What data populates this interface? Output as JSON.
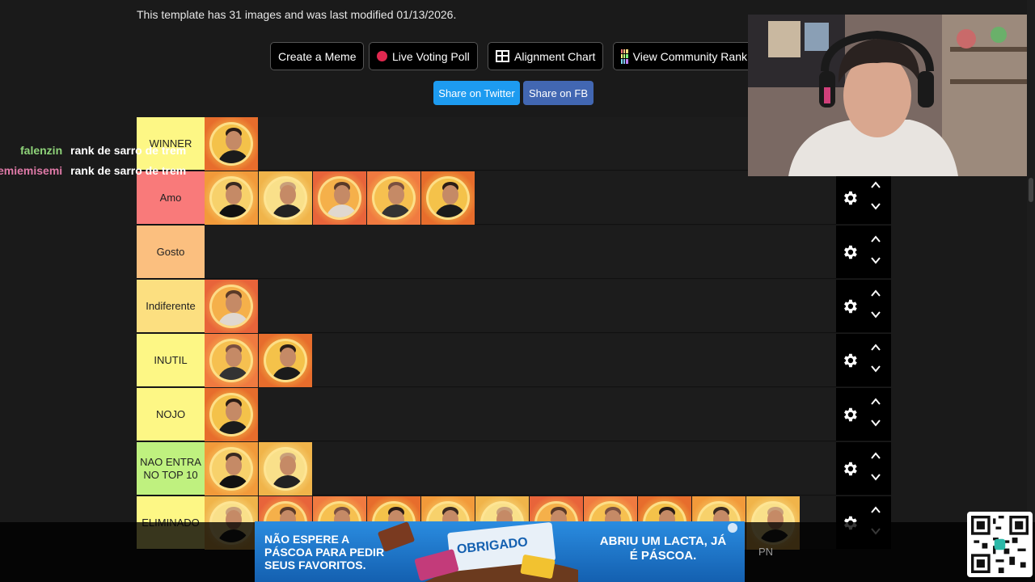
{
  "info_text": "This template has 31 images and was last modified 01/13/2026.",
  "buttons": {
    "create_meme": "Create a Meme",
    "live_poll": "Live Voting Poll",
    "alignment": "Alignment Chart",
    "community": "View Community Rank"
  },
  "share": {
    "twitter": "Share on Twitter",
    "fb": "Share on FB"
  },
  "chat": [
    {
      "user": "falenzin",
      "message": "rank de sarro de trem",
      "color": "#8fd47a"
    },
    {
      "user": "emiemisemi",
      "message": "rank de sarro de trem",
      "color": "#e07aa8"
    }
  ],
  "tiers": [
    {
      "label": "WINNER",
      "color": "#fdf785",
      "count": 1
    },
    {
      "label": "Amo",
      "color": "#f97a7a",
      "count": 5
    },
    {
      "label": "Gosto",
      "color": "#fbbf7f",
      "count": 0
    },
    {
      "label": "Indiferente",
      "color": "#fcdf80",
      "count": 1
    },
    {
      "label": "INUTIL",
      "color": "#fdf785",
      "count": 2
    },
    {
      "label": "NOJO",
      "color": "#fdf785",
      "count": 1
    },
    {
      "label": "NAO ENTRA NO TOP 10",
      "color": "#bff17f",
      "count": 2
    },
    {
      "label": "ELIMINADO",
      "color": "#fdf785",
      "count": 11
    }
  ],
  "overflow_label": "PN",
  "ad": {
    "left_text": "NÃO ESPERE A PÁSCOA PARA PEDIR SEUS FAVORITOS.",
    "product_text": "OBRIGADO",
    "right_text": "ABRIU UM LACTA, JÁ É PÁSCOA."
  },
  "colors": {
    "twitter": "#1d9bf0",
    "fb": "#4267b2",
    "background": "#1a1a1a"
  }
}
